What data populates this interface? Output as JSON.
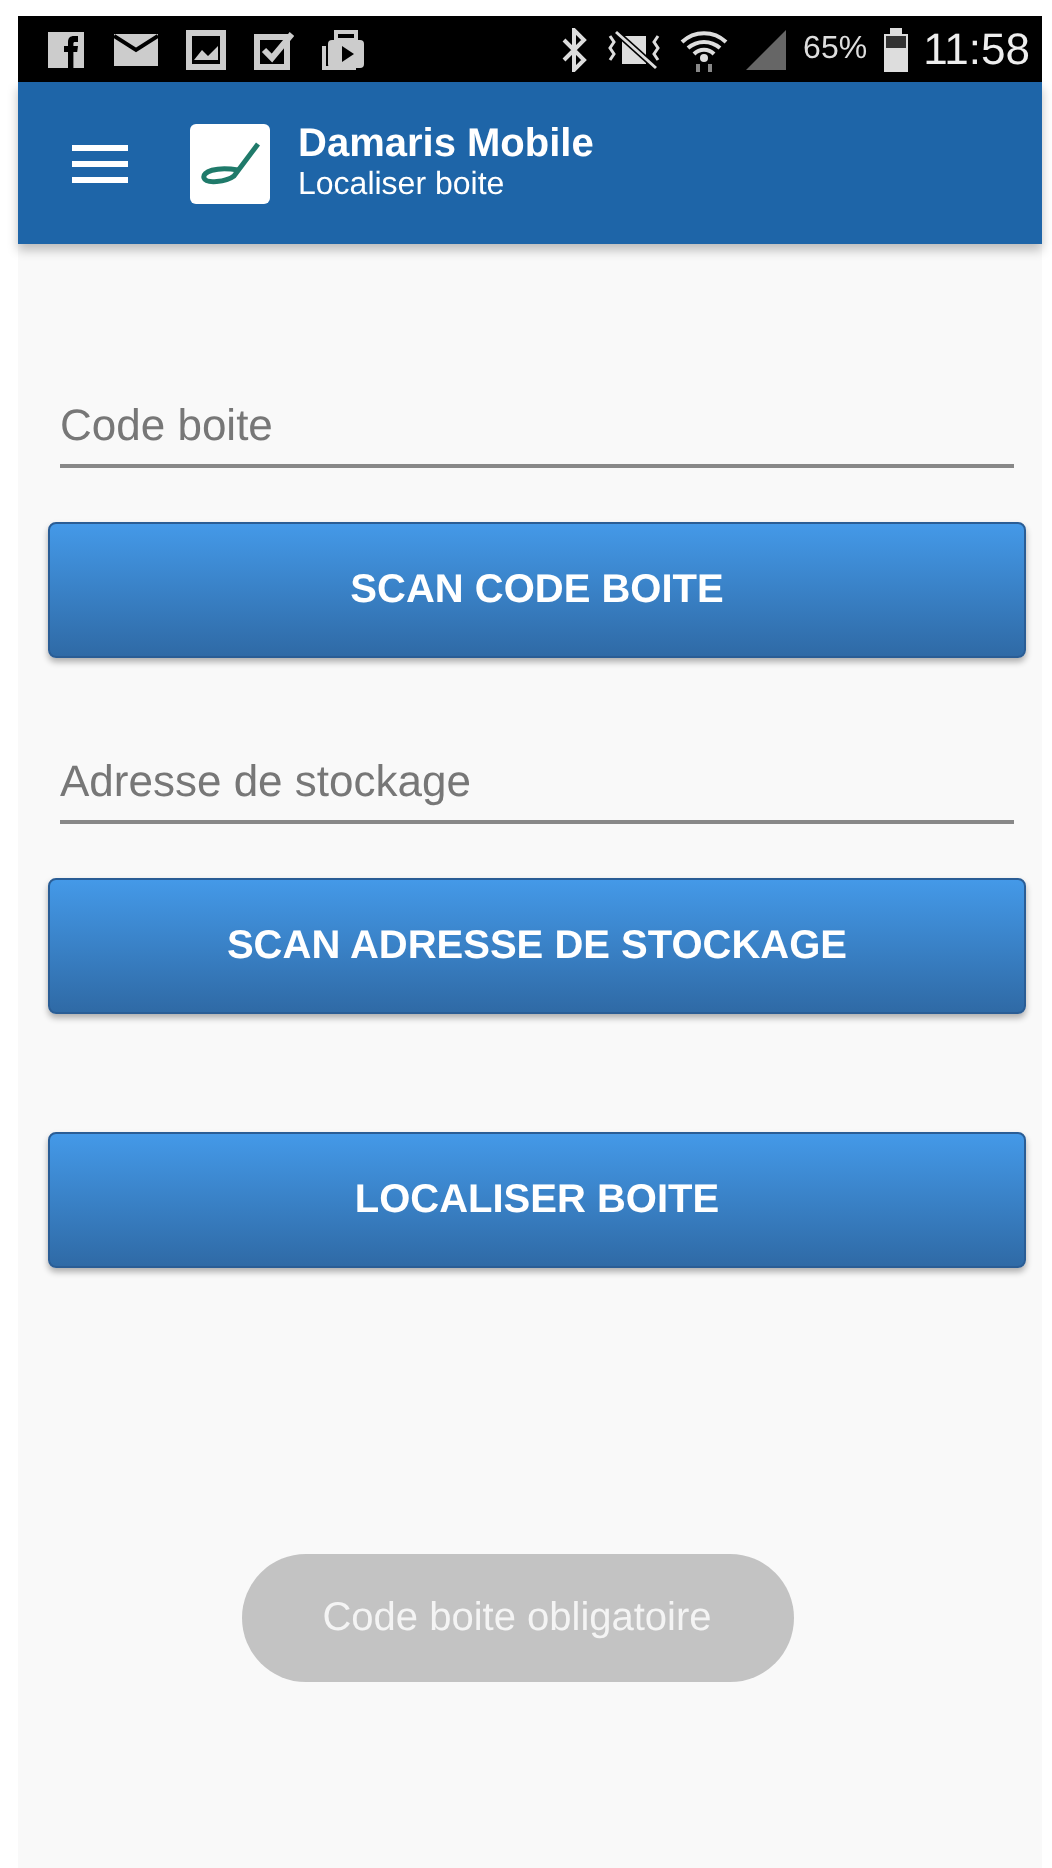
{
  "status_bar": {
    "battery_percent": "65%",
    "time": "11:58"
  },
  "app_bar": {
    "title": "Damaris Mobile",
    "subtitle": "Localiser boite"
  },
  "form": [
    {
      "kind": "field",
      "placeholder": "Code boite"
    },
    {
      "kind": "button",
      "label": "SCAN CODE BOITE"
    },
    {
      "kind": "field",
      "placeholder": "Adresse de stockage"
    },
    {
      "kind": "button",
      "label": "SCAN ADRESSE DE STOCKAGE"
    },
    {
      "kind": "spacer"
    },
    {
      "kind": "button",
      "label": "LOCALISER BOITE"
    }
  ],
  "toast": {
    "text": "Code boite obligatoire"
  }
}
